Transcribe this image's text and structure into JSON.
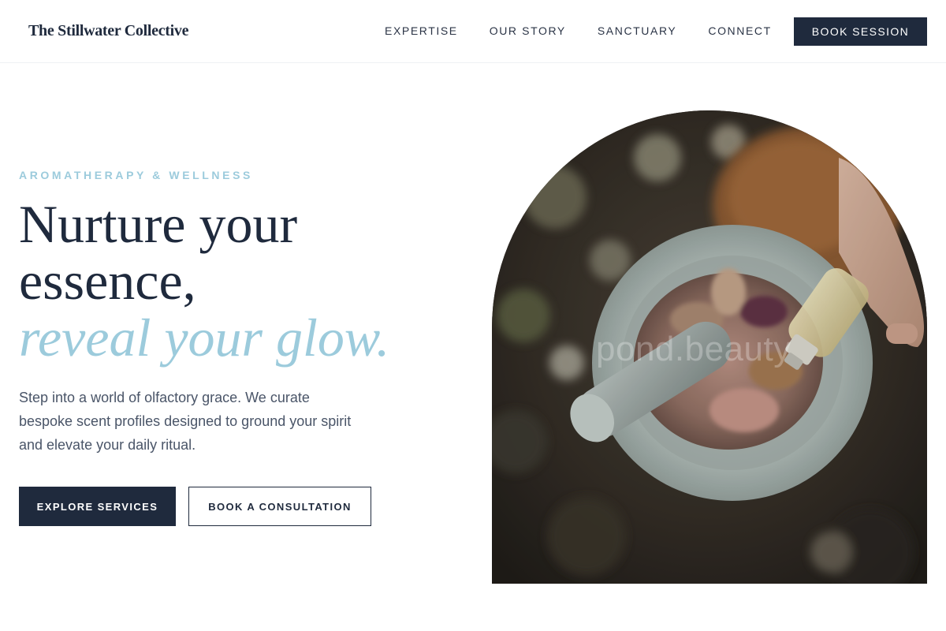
{
  "header": {
    "brand": "The Stillwater Collective",
    "nav": [
      {
        "label": "EXPERTISE"
      },
      {
        "label": "OUR STORY"
      },
      {
        "label": "SANCTUARY"
      },
      {
        "label": "CONNECT"
      }
    ],
    "cta_label": "BOOK SESSION"
  },
  "hero": {
    "eyebrow": "AROMATHERAPY & WELLNESS",
    "headline_line1": "Nurture your",
    "headline_line2": "essence,",
    "headline_accent": "reveal your glow.",
    "lead": "Step into a world of olfactory grace. We curate bespoke scent profiles designed to ground your spirit and elevate your daily ritual.",
    "primary_button": "EXPLORE SERVICES",
    "secondary_button": "BOOK A CONSULTATION",
    "image_watermark": "pond.beauty"
  },
  "colors": {
    "navy": "#1f2a3d",
    "accent_blue": "#9ccbdc",
    "body_text": "#4a5568"
  }
}
